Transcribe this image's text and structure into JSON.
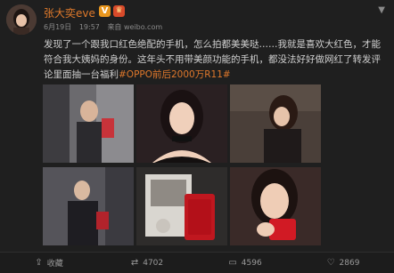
{
  "post": {
    "username": "张大奕eve",
    "verified_badge": "V",
    "crown_badge": "♛",
    "date": "6月19日",
    "time": "19:57",
    "source": "来自 weibo.com",
    "text_main": "发现了一个跟我口红色绝配的手机，怎么拍都美美哒……我就是喜欢大红色，才能符合我大姨妈的身份。这年头不用带美颜功能的手机，都没法好好做网红了转发评论里面抽一台福利",
    "hashtag": "#OPPO前后2000万R11#"
  },
  "actions": {
    "share_label": "收藏",
    "repost_count": "4702",
    "comment_count": "4596",
    "like_count": "2869"
  },
  "icons": {
    "avatar": "avatar-photo",
    "more": "chevron-down-icon",
    "share": "share-icon",
    "repost": "repost-icon",
    "comment": "comment-icon",
    "like": "like-icon"
  },
  "colors": {
    "accent": "#e07a2b",
    "background": "#1f1f1f",
    "text": "#cfcfcf",
    "meta": "#8a8a8a"
  }
}
